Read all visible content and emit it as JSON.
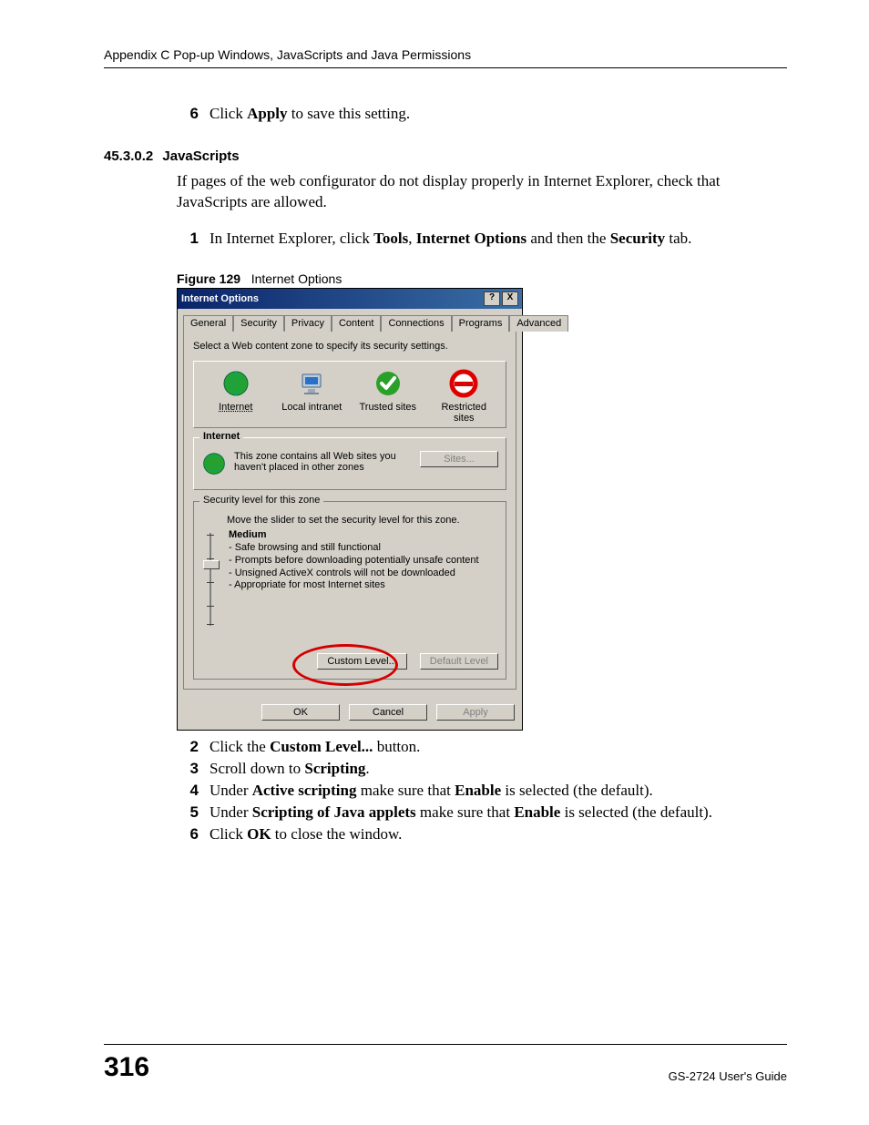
{
  "header": {
    "text": "Appendix C Pop-up Windows, JavaScripts and Java Permissions"
  },
  "step6": {
    "num": "6",
    "pre": "Click ",
    "bold": "Apply",
    "post": " to save this setting."
  },
  "section": {
    "num": "45.3.0.2",
    "title": "JavaScripts"
  },
  "intro": "If pages of the web configurator do not display properly in Internet Explorer, check that JavaScripts are allowed.",
  "step1": {
    "num": "1",
    "t1": "In Internet Explorer, click ",
    "b1": "Tools",
    "t2": ", ",
    "b2": "Internet Options",
    "t3": " and then the ",
    "b3": "Security",
    "t4": " tab."
  },
  "figure": {
    "label": "Figure 129",
    "caption": "Internet Options"
  },
  "dialog": {
    "title": "Internet Options",
    "help": "?",
    "close": "X",
    "tabs": [
      "General",
      "Security",
      "Privacy",
      "Content",
      "Connections",
      "Programs",
      "Advanced"
    ],
    "active_tab": 1,
    "zone_instruction": "Select a Web content zone to specify its security settings.",
    "zones": [
      {
        "label": "Internet"
      },
      {
        "label": "Local intranet"
      },
      {
        "label": "Trusted sites"
      },
      {
        "label": "Restricted sites"
      }
    ],
    "zone_box": {
      "name": "Internet",
      "desc": "This zone contains all Web sites you haven't placed in other zones",
      "sites_btn": "Sites..."
    },
    "sec": {
      "legend": "Security level for this zone",
      "move": "Move the slider to set the security level for this zone.",
      "level": "Medium",
      "bullets": [
        "- Safe browsing and still functional",
        "- Prompts before downloading potentially unsafe content",
        "- Unsigned ActiveX controls will not be downloaded",
        "- Appropriate for most Internet sites"
      ],
      "custom": "Custom Level...",
      "default": "Default Level"
    },
    "footer": {
      "ok": "OK",
      "cancel": "Cancel",
      "apply": "Apply"
    }
  },
  "step2": {
    "num": "2",
    "t1": "Click the ",
    "b1": "Custom Level...",
    "t2": " button."
  },
  "step3": {
    "num": "3",
    "t1": "Scroll down to ",
    "b1": "Scripting",
    "t2": "."
  },
  "step4": {
    "num": "4",
    "t1": "Under ",
    "b1": "Active scripting",
    "t2": " make sure that ",
    "b2": "Enable",
    "t3": " is selected (the default)."
  },
  "step5": {
    "num": "5",
    "t1": "Under ",
    "b1": "Scripting of Java applets",
    "t2": " make sure that ",
    "b2": "Enable",
    "t3": " is selected (the default)."
  },
  "step6b": {
    "num": "6",
    "t1": "Click ",
    "b1": "OK",
    "t2": " to close the window."
  },
  "footer": {
    "page": "316",
    "guide": "GS-2724 User's Guide"
  }
}
